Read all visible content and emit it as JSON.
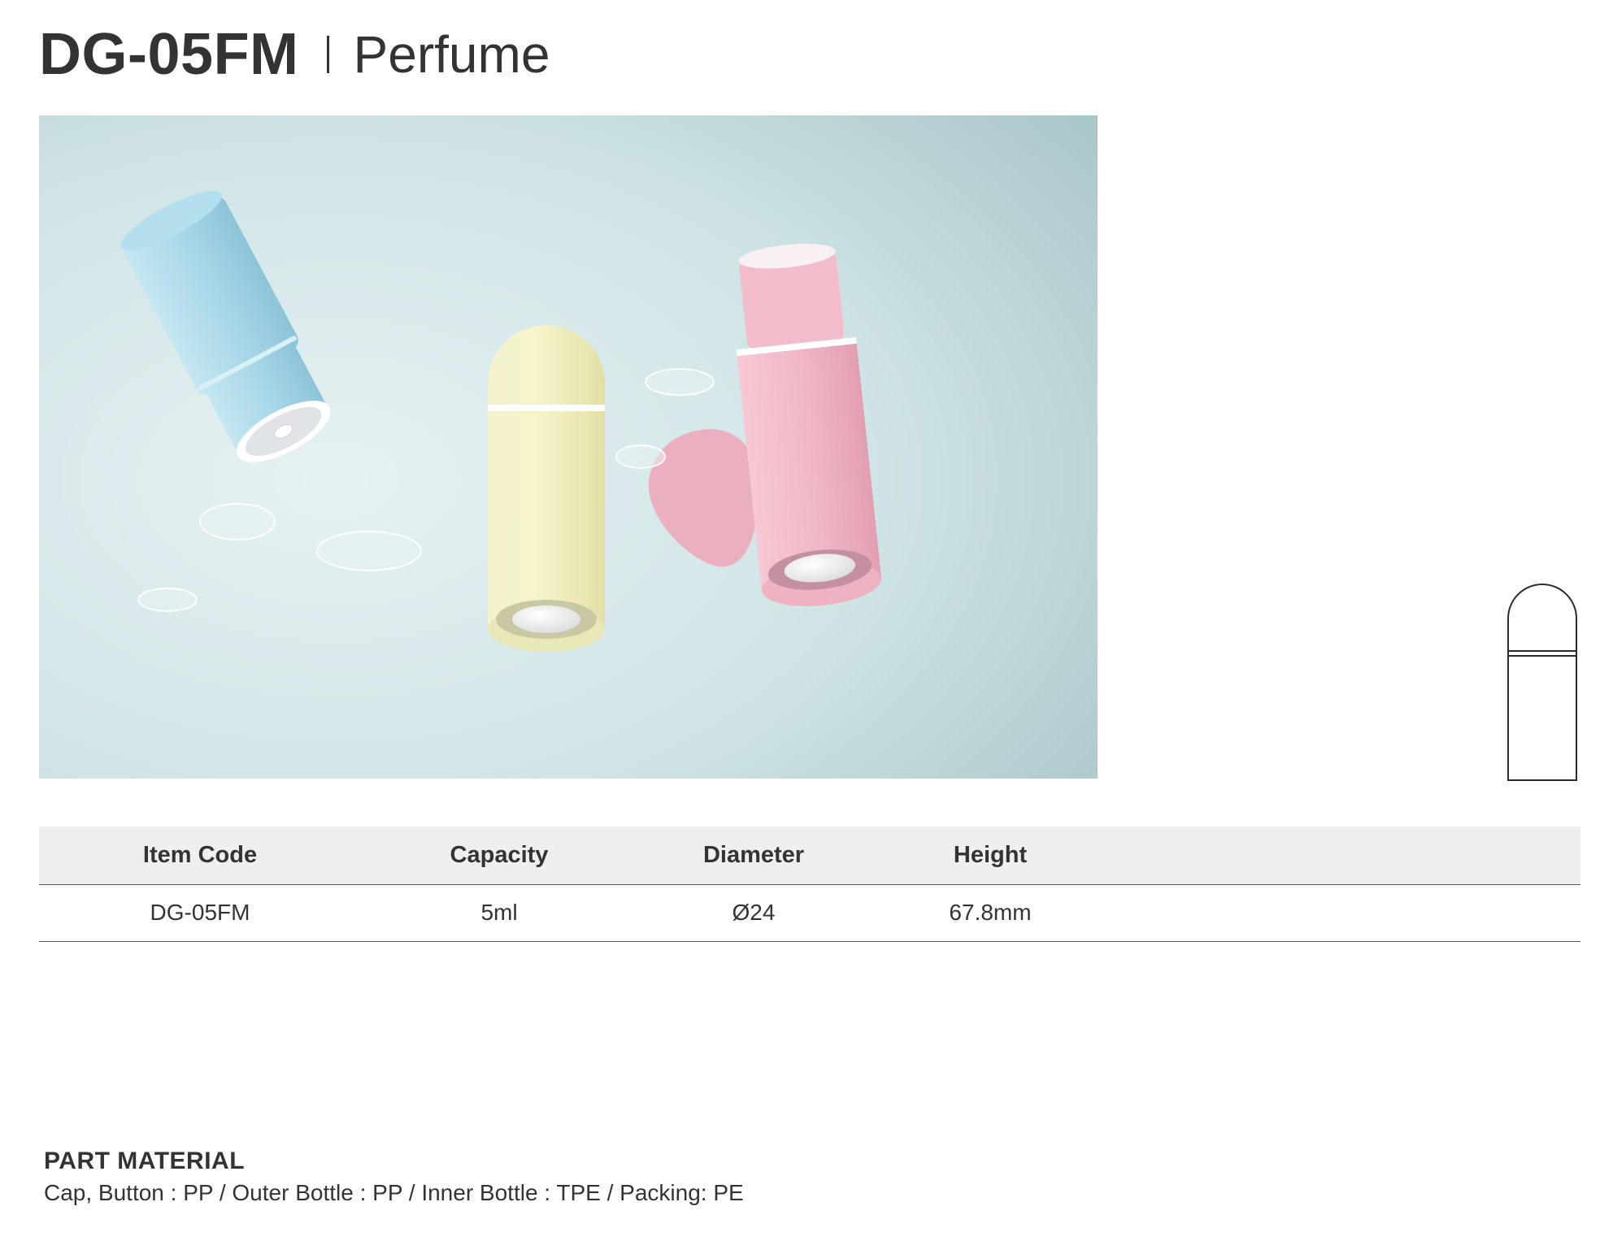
{
  "header": {
    "model_code": "DG-05FM",
    "category": "Perfume"
  },
  "hero_image": {
    "subject": "three roll-on perfume bottles with water droplets",
    "colors": {
      "background_light": "#dcecee",
      "background_dark": "#a9c8ca",
      "blue": "#aad8e8",
      "yellow": "#f3f2c6",
      "pink": "#f0b8c6"
    }
  },
  "spec_table": {
    "headers": [
      "Item Code",
      "Capacity",
      "Diameter",
      "Height"
    ],
    "rows": [
      [
        "DG-05FM",
        "5ml",
        "Ø24",
        "67.8mm"
      ]
    ]
  },
  "part_material": {
    "title": "PART MATERIAL",
    "text": "Cap, Button : PP / Outer Bottle : PP / Inner Bottle : TPE / Packing: PE"
  }
}
